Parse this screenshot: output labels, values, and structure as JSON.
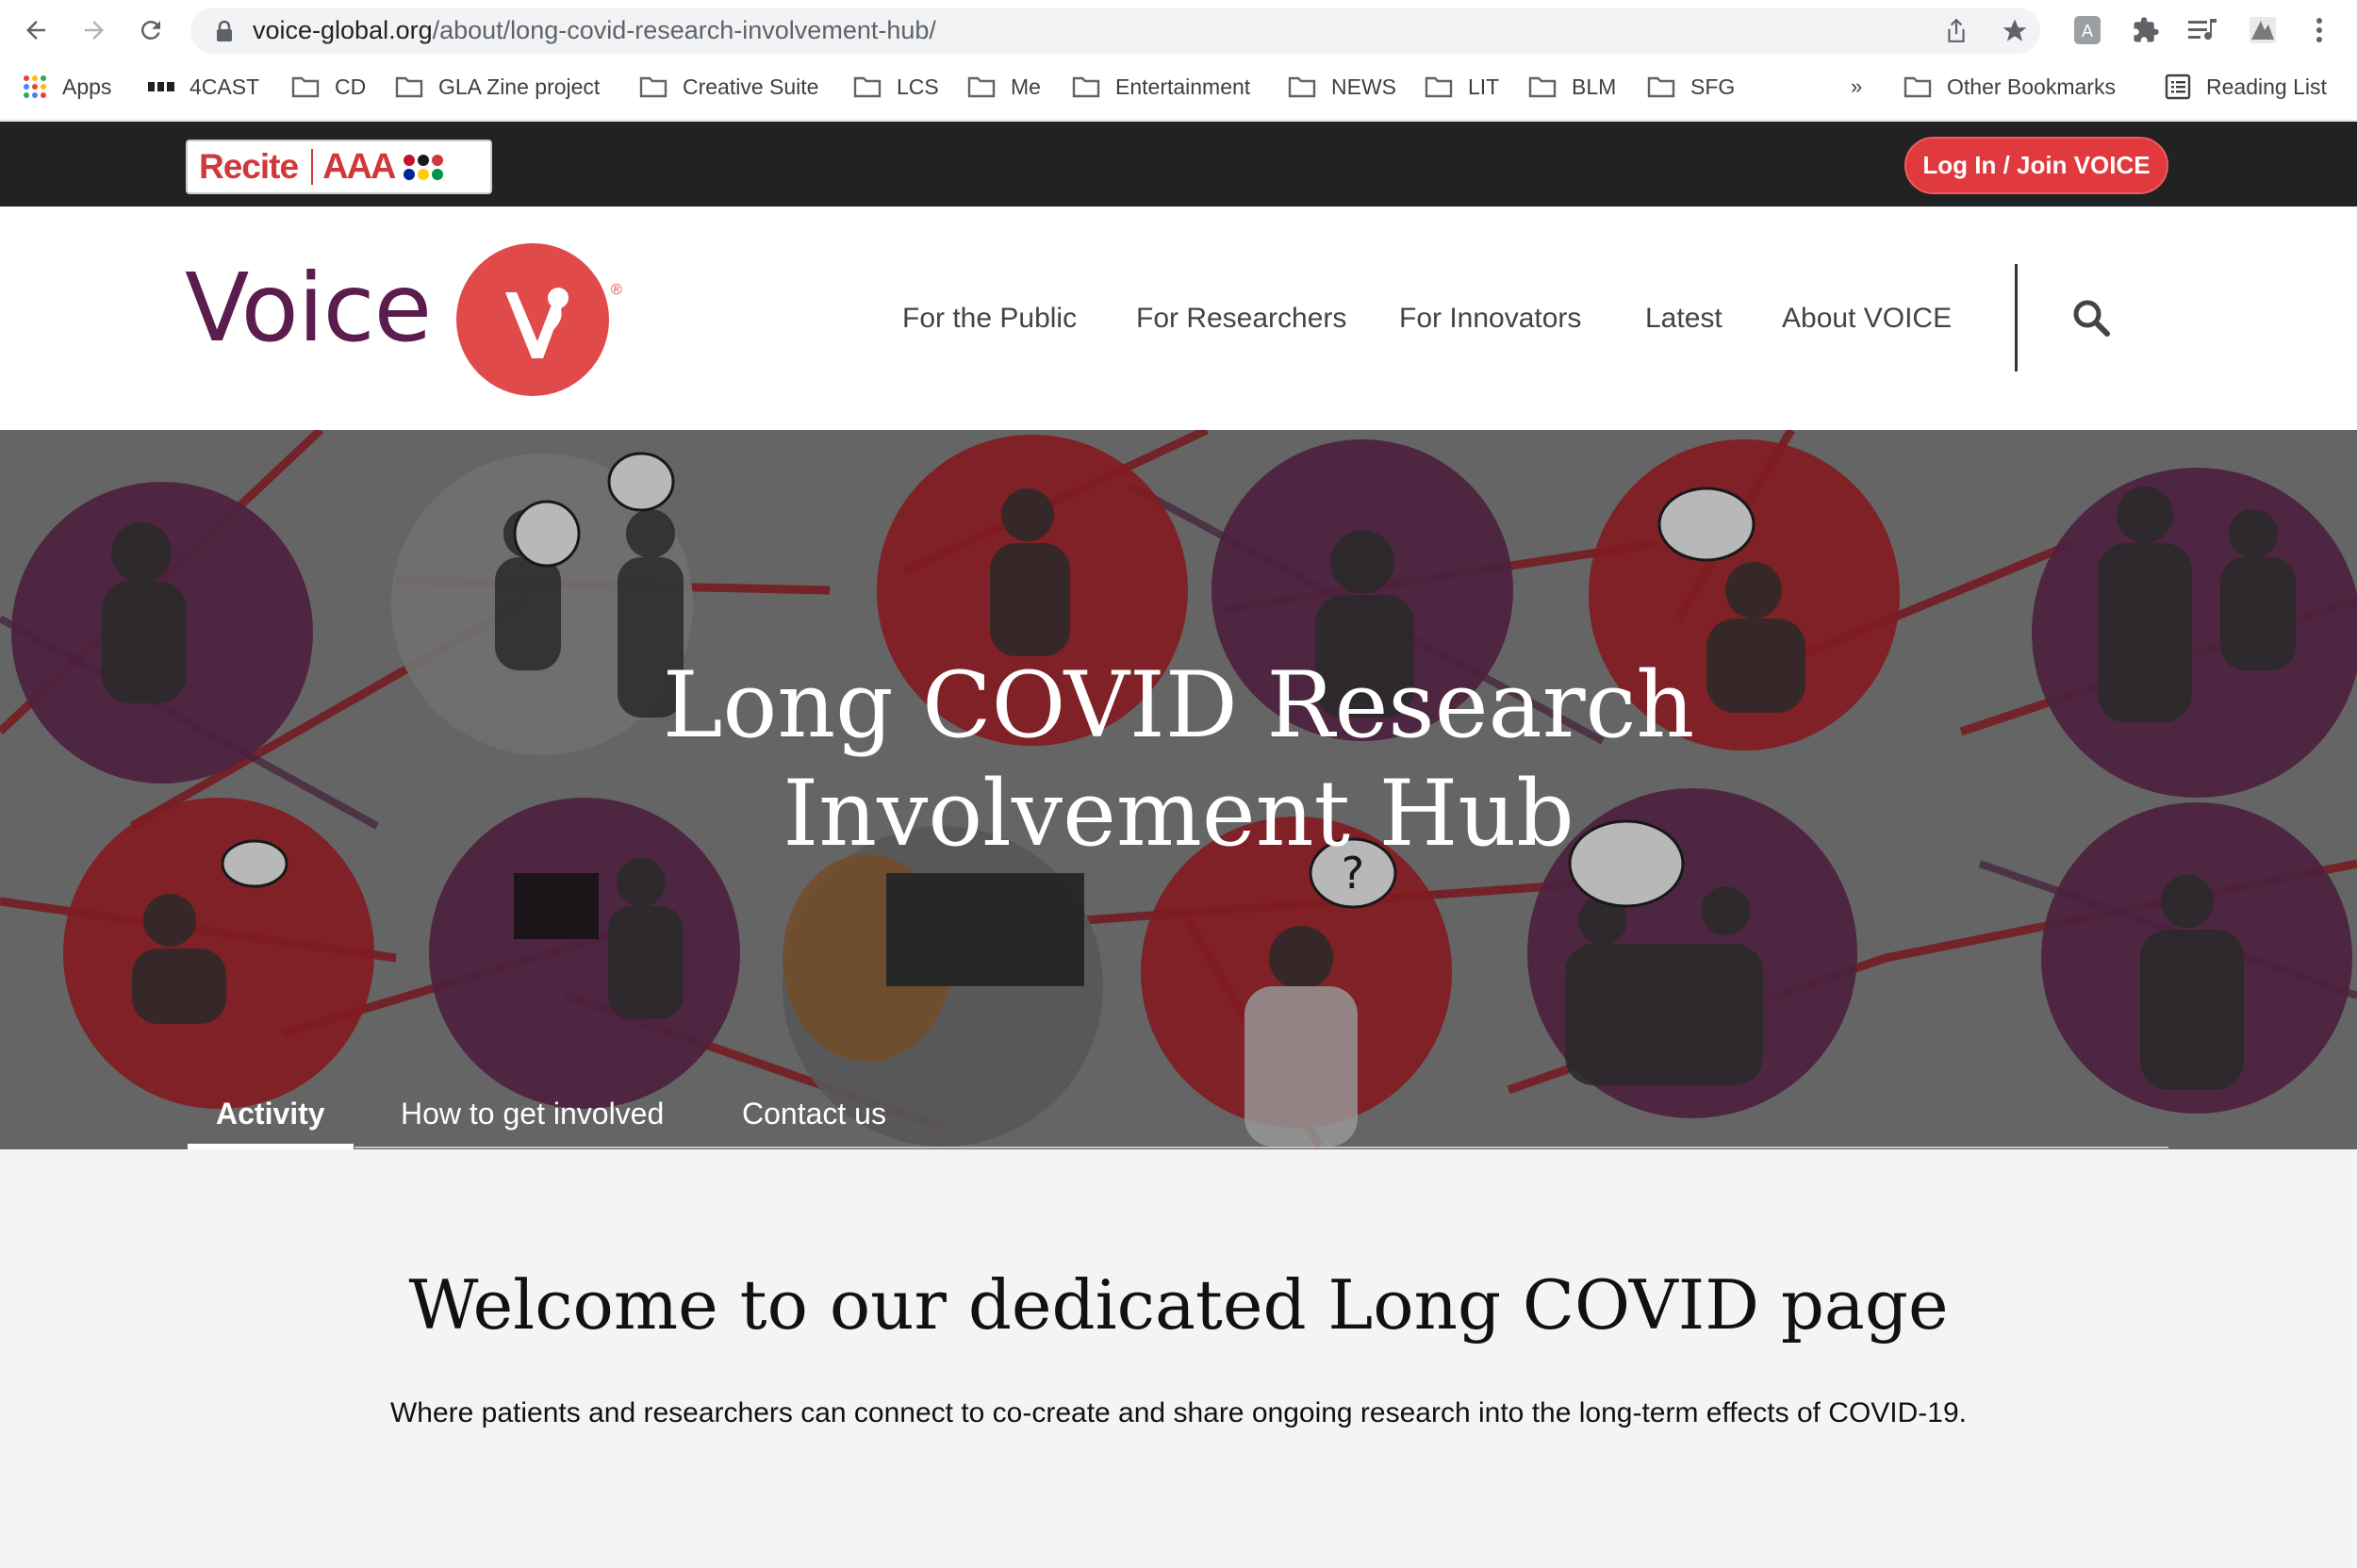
{
  "browser": {
    "url_domain": "voice-global.org",
    "url_path": "/about/long-covid-research-involvement-hub/",
    "bookmarks": [
      {
        "label": "Apps",
        "icon": "apps-grid-icon"
      },
      {
        "label": "4CAST",
        "icon": "bars-icon"
      },
      {
        "label": "CD",
        "icon": "folder-icon"
      },
      {
        "label": "GLA Zine project",
        "icon": "folder-icon"
      },
      {
        "label": "Creative Suite",
        "icon": "folder-icon"
      },
      {
        "label": "LCS",
        "icon": "folder-icon"
      },
      {
        "label": "Me",
        "icon": "folder-icon"
      },
      {
        "label": "Entertainment",
        "icon": "folder-icon"
      },
      {
        "label": "NEWS",
        "icon": "folder-icon"
      },
      {
        "label": "LIT",
        "icon": "folder-icon"
      },
      {
        "label": "BLM",
        "icon": "folder-icon"
      },
      {
        "label": "SFG",
        "icon": "folder-icon"
      }
    ],
    "overflow": "»",
    "other_bookmarks": "Other Bookmarks",
    "reading_list": "Reading List"
  },
  "sitebar": {
    "recite_label": "Recite",
    "aaa_label": "AAA",
    "login_label": "Log In / Join VOICE",
    "login_color": "#e03a3e"
  },
  "header": {
    "logo_text": "Voice",
    "logo_mark": "®",
    "nav": [
      "For the Public",
      "For Researchers",
      "For Innovators",
      "Latest",
      "About VOICE"
    ],
    "brand_color": "#5a1d4e",
    "accent_color": "#e04a4b"
  },
  "hero": {
    "title_line1": "Long COVID Research",
    "title_line2": "Involvement Hub",
    "tabs": [
      "Activity",
      "How to get involved",
      "Contact us"
    ],
    "active_tab": "Activity",
    "bubble_text": "?"
  },
  "welcome": {
    "title": "Welcome to our dedicated Long COVID page",
    "subtitle": "Where patients and researchers can connect to co-create and share ongoing research into the long-term effects of COVID-19."
  }
}
